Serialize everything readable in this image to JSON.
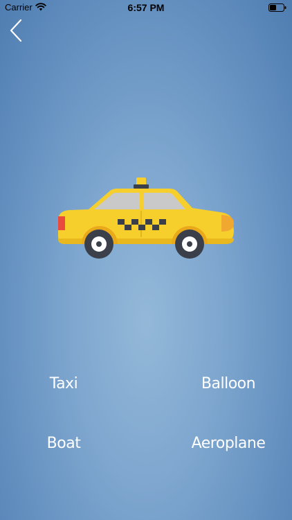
{
  "status_bar": {
    "carrier": "Carrier",
    "time": "6:57 PM",
    "icons": [
      "wifi-icon",
      "battery-icon"
    ]
  },
  "navigation": {
    "back_icon": "chevron-left-icon"
  },
  "question": {
    "image": "taxi-car-illustration"
  },
  "options": [
    {
      "label": "Taxi"
    },
    {
      "label": "Balloon"
    },
    {
      "label": "Boat"
    },
    {
      "label": "Aeroplane"
    }
  ],
  "colors": {
    "background": "#7fa7cf",
    "taxi_yellow": "#f7cf2c",
    "option_text": "#ffffff"
  }
}
